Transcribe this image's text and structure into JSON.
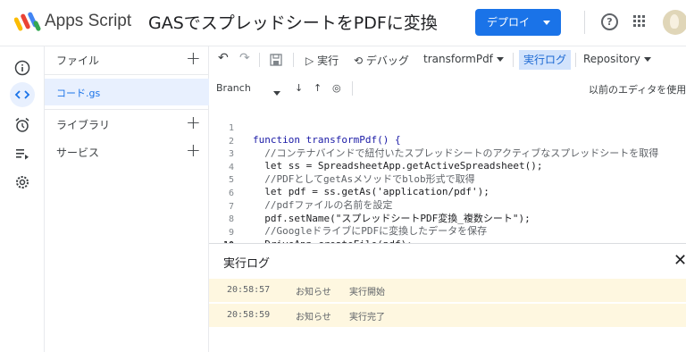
{
  "header": {
    "app_name": "Apps Script",
    "project_title": "GASでスプレッドシートをPDFに変換",
    "deploy_label": "デプロイ",
    "help_icon": "?"
  },
  "rail": {
    "icons": [
      "info-icon",
      "code-icon",
      "alarm-icon",
      "executions-icon",
      "settings-icon"
    ],
    "active": "code-icon"
  },
  "files_panel": {
    "files_label": "ファイル",
    "file_name": "コード.gs",
    "libraries_label": "ライブラリ",
    "services_label": "サービス"
  },
  "toolbar": {
    "run_label": "実行",
    "debug_label": "デバッグ",
    "function_select": "transformPdf",
    "exec_log_label": "実行ログ",
    "repository_label": "Repository"
  },
  "debugbar": {
    "branch_label": "Branch",
    "legacy_editor_label": "以前のエディタを使用"
  },
  "code": {
    "lines": [
      {
        "n": "1",
        "text": "function transformPdf() {"
      },
      {
        "n": "2",
        "text": "  //コンテナバインドで紐付いたスプレッドシートのアクティブなスプレッドシートを取得"
      },
      {
        "n": "3",
        "text": "  let ss = SpreadsheetApp.getActiveSpreadsheet();"
      },
      {
        "n": "4",
        "text": "  //PDFとしてgetAsメソッドでblob形式で取得"
      },
      {
        "n": "5",
        "text": "  let pdf = ss.getAs('application/pdf');"
      },
      {
        "n": "6",
        "text": "  //pdfファイルの名前を設定"
      },
      {
        "n": "7",
        "text": "  pdf.setName(\"スプレッドシートPDF変換_複数シート\");"
      },
      {
        "n": "8",
        "text": "  //GoogleドライブにPDFに変換したデータを保存"
      },
      {
        "n": "9",
        "text": "  DriveApp.createFile(pdf);"
      },
      {
        "n": "10",
        "text": "}"
      }
    ]
  },
  "log": {
    "title": "実行ログ",
    "close": "✕",
    "entries": [
      {
        "time": "20:58:57",
        "level": "お知らせ",
        "message": "実行開始"
      },
      {
        "time": "20:58:59",
        "level": "お知らせ",
        "message": "実行完了"
      }
    ]
  },
  "colors": {
    "accent": "#1a73e8",
    "active_bg": "#e8f0fe",
    "log_row_bg": "#fef7e0"
  }
}
